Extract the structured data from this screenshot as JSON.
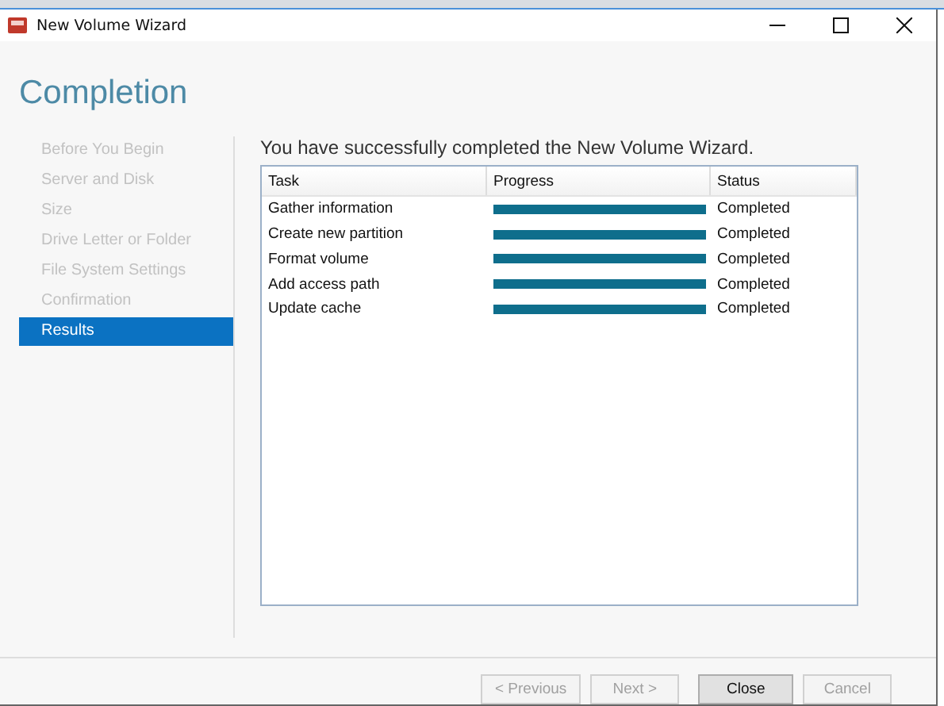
{
  "window": {
    "title": "New Volume Wizard"
  },
  "page_title": "Completion",
  "steps": [
    {
      "label": "Before You Begin",
      "selected": false
    },
    {
      "label": "Server and Disk",
      "selected": false
    },
    {
      "label": "Size",
      "selected": false
    },
    {
      "label": "Drive Letter or Folder",
      "selected": false
    },
    {
      "label": "File System Settings",
      "selected": false
    },
    {
      "label": "Confirmation",
      "selected": false
    },
    {
      "label": "Results",
      "selected": true
    }
  ],
  "message": "You have successfully completed the New Volume Wizard.",
  "table": {
    "columns": [
      "Task",
      "Progress",
      "Status"
    ],
    "rows": [
      {
        "task": "Gather information",
        "level": 1,
        "status": "Completed"
      },
      {
        "task": "Create new partition",
        "level": 1,
        "status": "Completed"
      },
      {
        "task": "Format volume",
        "level": 1,
        "status": "Completed"
      },
      {
        "task": "Add access path",
        "level": 1,
        "status": "Completed"
      },
      {
        "task": "Update cache",
        "level": 1,
        "status": "Completed"
      }
    ]
  },
  "buttons": [
    {
      "label": "< Previous",
      "disabled": true
    },
    {
      "label": "Next >",
      "disabled": true
    },
    {
      "label": "Close",
      "disabled": false
    },
    {
      "label": "Cancel",
      "disabled": true
    }
  ]
}
